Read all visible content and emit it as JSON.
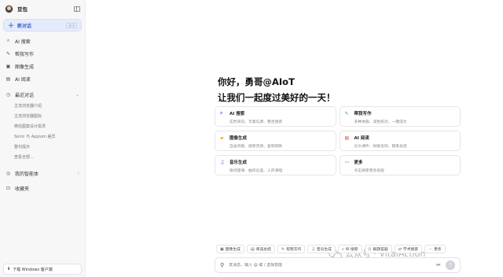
{
  "sidebar": {
    "brand": "豆包",
    "new_chat": {
      "label": "新对话",
      "shortcut": "⌘ K"
    },
    "nav": [
      {
        "icon": "ai-search-icon",
        "glyph": "⌕",
        "label": "AI 搜索"
      },
      {
        "icon": "writing-icon",
        "glyph": "✎",
        "label": "帮我写作"
      },
      {
        "icon": "image-gen-icon",
        "glyph": "▣",
        "label": "图像生成"
      },
      {
        "icon": "ai-read-icon",
        "glyph": "▤",
        "label": "AI 阅读"
      }
    ],
    "recent_header": "最近对话",
    "recent": [
      "主流浏览器介绍",
      "主流浏览器图标",
      "微信图案设计需求",
      "Sonic 与 Appium 差异",
      "整句提示",
      "查看全部..."
    ],
    "agents": "我的智能体",
    "favorites": "收藏夹",
    "download": "下载 Windows 客户端"
  },
  "main": {
    "greeting_line1": "你好，勇哥@AIoT",
    "greeting_line2": "让我们一起度过美好的一天！",
    "cards": [
      {
        "icon": "search-icon",
        "glyph": "⌕",
        "color": "#2f6cf0",
        "title": "AI 搜索",
        "desc": "实时资讯、丰富信源、整合搜索"
      },
      {
        "icon": "pen-icon",
        "glyph": "✎",
        "color": "#2aa86b",
        "title": "帮我写作",
        "desc": "多种体裁、润色校对，一键成文"
      },
      {
        "icon": "image-icon",
        "glyph": "▰",
        "color": "#f0a020",
        "title": "图像生成",
        "desc": "自由风格、搜索灵感、复制同款"
      },
      {
        "icon": "reader-icon",
        "glyph": "▤",
        "color": "#e0433a",
        "title": "AI 阅读",
        "desc": "论文课件、财报合同、题率总结"
      },
      {
        "icon": "music-icon",
        "glyph": "♫",
        "color": "#8a4be0",
        "title": "音乐生成",
        "desc": "歌词旋律、曲风任选、人声演唱"
      },
      {
        "icon": "more-icon",
        "glyph": "⋯",
        "color": "#888888",
        "title": "更多",
        "desc": "点击探索更多技能"
      }
    ],
    "chips": [
      {
        "icon": "image-icon",
        "glyph": "▣",
        "label": "图像生成"
      },
      {
        "icon": "reader-icon",
        "glyph": "▤",
        "label": "阅读总结"
      },
      {
        "icon": "pen-icon",
        "glyph": "✎",
        "label": "帮我写作"
      },
      {
        "icon": "music-icon",
        "glyph": "♫",
        "label": "音乐生成"
      },
      {
        "icon": "search-icon",
        "glyph": "⌕",
        "label": "AI 搜索"
      },
      {
        "icon": "code-icon",
        "glyph": "⟨⟩",
        "label": "解题答疑"
      },
      {
        "icon": "translate-icon",
        "glyph": "⇄",
        "label": "学术搜索"
      },
      {
        "icon": "more-icon",
        "glyph": "⋯",
        "label": "更多"
      }
    ],
    "input_placeholder": "发消息、输入 @ 或 / 选择技能",
    "watermark": "公众号 · VitalAction"
  }
}
